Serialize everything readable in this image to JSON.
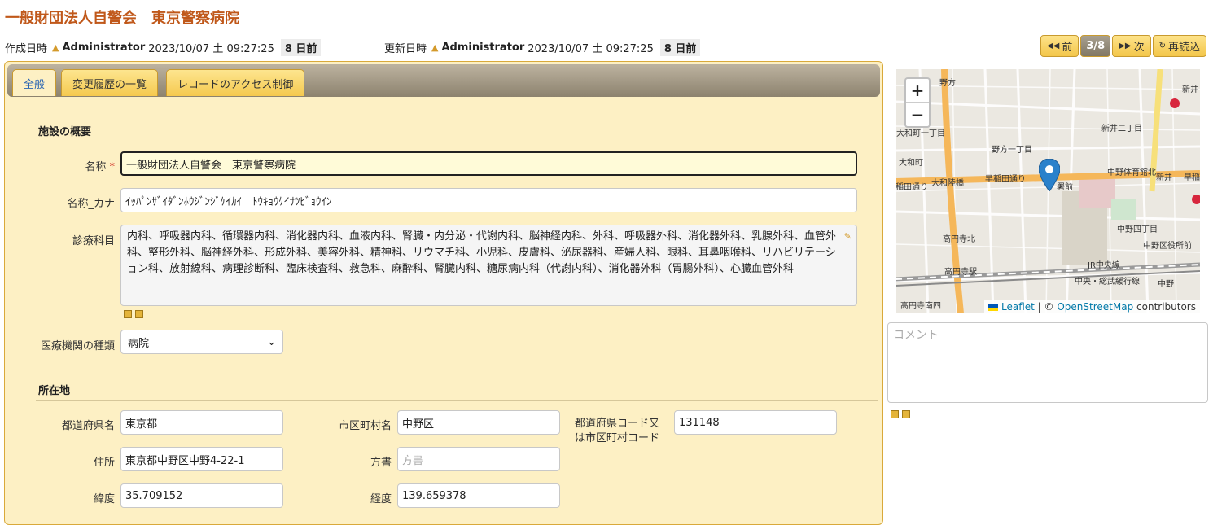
{
  "title": "一般財団法人自警会　東京警察病院",
  "meta": {
    "created_label": "作成日時",
    "created_user": "Administrator",
    "created_date": "2023/10/07 土 09:27:25",
    "created_ago": "8 日前",
    "updated_label": "更新日時",
    "updated_user": "Administrator",
    "updated_date": "2023/10/07 土 09:27:25",
    "updated_ago": "8 日前"
  },
  "nav": {
    "prev": "前",
    "page": "3/8",
    "next": "次",
    "reload": "再読込"
  },
  "tabs": [
    "全般",
    "変更履歴の一覧",
    "レコードのアクセス制御"
  ],
  "sections": {
    "overview": "施設の概要",
    "location": "所在地"
  },
  "fields": {
    "name_label": "名称",
    "name_required": "*",
    "name_value": "一般財団法人自警会　東京警察病院",
    "kana_label": "名称_カナ",
    "kana_value": "ｲｯﾊﾟﾝｻﾞｲﾀﾞﾝﾎｳｼﾞﾝｼﾞｹｲｶｲ　ﾄｳｷｮｳｹｲｻﾂﾋﾞｮｳｲﾝ",
    "dept_label": "診療科目",
    "dept_value": "内科、呼吸器内科、循環器内科、消化器内科、血液内科、腎臓・内分泌・代謝内科、脳神経内科、外科、呼吸器外科、消化器外科、乳腺外科、血管外科、整形外科、脳神経外科、形成外科、美容外科、精神科、リウマチ科、小児科、皮膚科、泌尿器科、産婦人科、眼科、耳鼻咽喉科、リハビリテーション科、放射線科、病理診断科、臨床検査科、救急科、麻酔科、腎臓内科、糖尿病内科（代謝内科）、消化器外科（胃腸外科）、心臓血管外科",
    "type_label": "医療機関の種類",
    "type_value": "病院",
    "pref_label": "都道府県名",
    "pref_value": "東京都",
    "city_label": "市区町村名",
    "city_value": "中野区",
    "code_label": "都道府県コード又は市区町村コード",
    "code_value": "131148",
    "address_label": "住所",
    "address_value": "東京都中野区中野4-22-1",
    "direction_label": "方書",
    "direction_placeholder": "方書",
    "lat_label": "緯度",
    "lat_value": "35.709152",
    "lng_label": "経度",
    "lng_value": "139.659378"
  },
  "map": {
    "zoom_in": "+",
    "zoom_out": "−",
    "attribution_leaflet": "Leaflet",
    "attribution_sep": " | © ",
    "attribution_osm": "OpenStreetMap",
    "attribution_tail": " contributors",
    "labels": [
      "野方",
      "新井",
      "大和町一丁目",
      "新井二丁目",
      "野方一丁目",
      "大和町",
      "大和陸橋",
      "早稲田通り",
      "中野体育館北",
      "新井",
      "早稲",
      "稲田通り",
      "署前",
      "中野四丁目",
      "高円寺北",
      "中野区役所前",
      "高円寺駅",
      "JR中央線",
      "中央・総武緩行線",
      "中野",
      "高円寺南四"
    ]
  },
  "comment_placeholder": "コメント"
}
